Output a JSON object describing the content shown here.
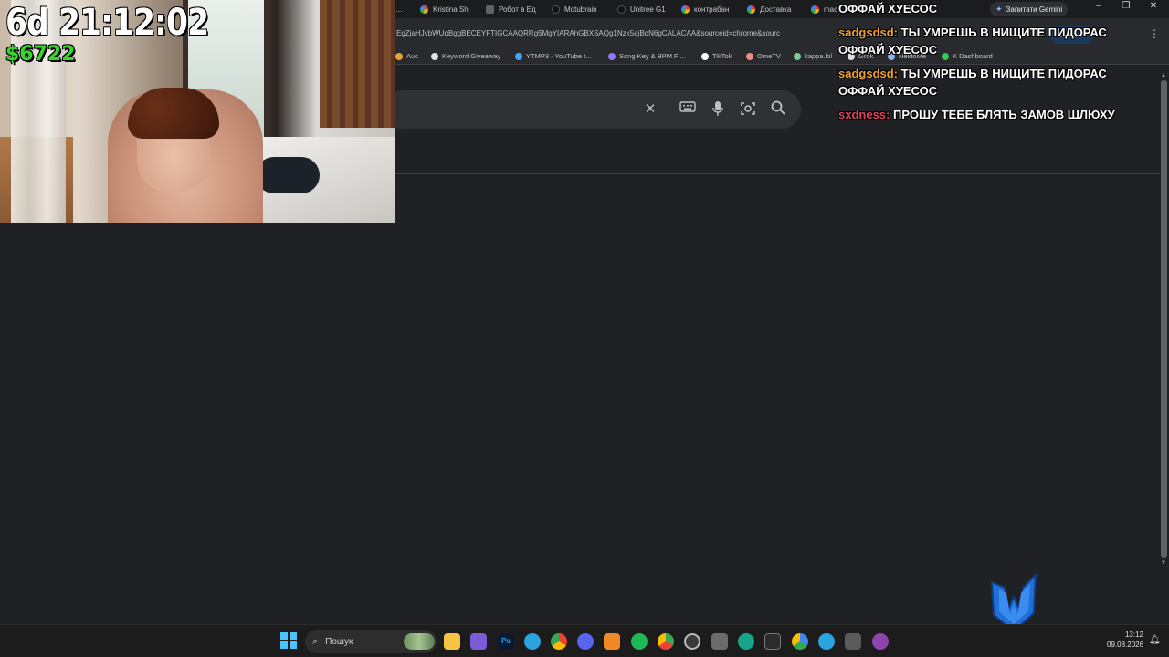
{
  "stream_overlay": {
    "timer": "6d 21:12:02",
    "money": "$6722"
  },
  "browser": {
    "tabs": [
      {
        "label": "Kristina Sh",
        "icon": "google-icon"
      },
      {
        "label": "Робот в Ед",
        "icon": "site-icon"
      },
      {
        "label": "Motubrain",
        "icon": "site-icon"
      },
      {
        "label": "Unitree G1",
        "icon": "site-icon"
      },
      {
        "label": "контрабан",
        "icon": "google-icon"
      },
      {
        "label": "Доставка",
        "icon": "google-icon"
      },
      {
        "label": "mac",
        "icon": "google-icon"
      }
    ],
    "gemini_label": "Запитати Gemini",
    "url": "EgZjaHJvbWUqBggBECEYFTIGCAAQRRg5MgYIARAhGBXSAQg1Nzk5ajBqN6gCALACAA&sourceid=chrome&sourc",
    "update_label": "Оновити",
    "bookmarks": [
      {
        "label": "Auc",
        "color": "#e8a33d"
      },
      {
        "label": "Keyword Giveaway",
        "color": "#e0e0e0"
      },
      {
        "label": "YTMP3 - YouTube t...",
        "color": "#3ea6ff"
      },
      {
        "label": "Song Key & BPM Fi...",
        "color": "#8a7cf7"
      },
      {
        "label": "TikTok",
        "color": "#ffffff"
      },
      {
        "label": "OmeTV",
        "color": "#f28b82"
      },
      {
        "label": "kappa.lol",
        "color": "#81c995"
      },
      {
        "label": "Grok",
        "color": "#e0e0e0"
      },
      {
        "label": "NektoMe",
        "color": "#8ab4f8"
      },
      {
        "label": "K Dashboard",
        "color": "#34c759"
      }
    ]
  },
  "chat": [
    {
      "user": "",
      "text": "ОФФАЙ ХУЕСОС",
      "user_color": "#ffffff"
    },
    {
      "user": "sadgsdsd:",
      "text": "ТЫ УМРЕШЬ В НИЩИТЕ ПИДОРАС",
      "user_color": "#f0a030"
    },
    {
      "user": "",
      "text": "ОФФАЙ ХУЕСОС",
      "user_color": "#ffffff"
    },
    {
      "user": "sadgsdsd:",
      "text": "ТЫ УМРЕШЬ В НИЩИТЕ ПИДОРАС",
      "user_color": "#f0a030"
    },
    {
      "user": "",
      "text": "ОФФАЙ ХУЕСОС",
      "user_color": "#ffffff"
    },
    {
      "user": "sxdness:",
      "text": "ПРОШУ ТЕБЕ БЛЯТЬ ЗАМОВ ШЛЮХУ",
      "user_color": "#e0405a"
    }
  ],
  "taskbar": {
    "search_placeholder": "Пошук",
    "time": "13:12",
    "date": "09.08.2026",
    "icons": [
      {
        "name": "file-explorer-icon",
        "color": "#f6c343"
      },
      {
        "name": "app-store-icon",
        "color": "#7b5cd6"
      },
      {
        "name": "photoshop-icon",
        "color": "#0a1a33"
      },
      {
        "name": "telegram-icon",
        "color": "#2aa3df"
      },
      {
        "name": "chrome-icon",
        "color": "#4285f4"
      },
      {
        "name": "discord-icon",
        "color": "#5865f2"
      },
      {
        "name": "fl-studio-icon",
        "color": "#f08a24"
      },
      {
        "name": "spotify-icon",
        "color": "#1db954"
      },
      {
        "name": "chrome-profile-icon",
        "color": "#34a853"
      },
      {
        "name": "obs-icon",
        "color": "#3a3a3a"
      },
      {
        "name": "app-icon",
        "color": "#6b6b6b"
      },
      {
        "name": "edge-icon",
        "color": "#1aa38a"
      },
      {
        "name": "terminal-icon",
        "color": "#2b2b2b"
      },
      {
        "name": "chrome-active-icon",
        "color": "#4285f4"
      },
      {
        "name": "messenger-icon",
        "color": "#2aa3df"
      },
      {
        "name": "calculator-icon",
        "color": "#5a5a5a"
      },
      {
        "name": "media-player-icon",
        "color": "#8e44ad"
      }
    ]
  }
}
